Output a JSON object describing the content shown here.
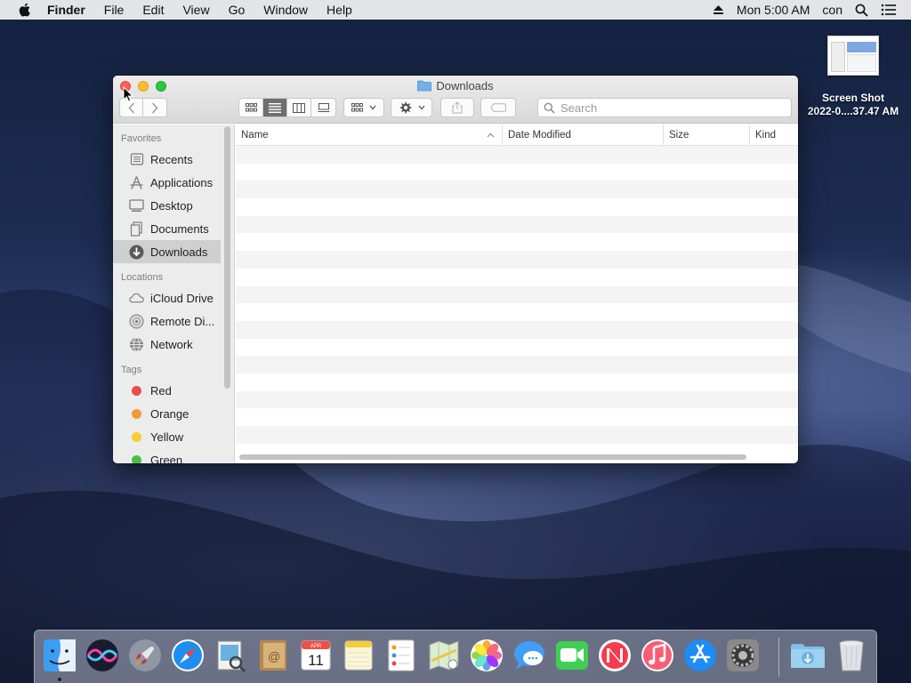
{
  "menubar": {
    "app": "Finder",
    "items": [
      "File",
      "Edit",
      "View",
      "Go",
      "Window",
      "Help"
    ],
    "clock": "Mon 5:00 AM",
    "user": "con"
  },
  "desktop": {
    "icon_label_line1": "Screen Shot",
    "icon_label_line2": "2022-0....37.47 AM"
  },
  "window": {
    "title": "Downloads",
    "search_placeholder": "Search",
    "columns": [
      "Name",
      "Date Modified",
      "Size",
      "Kind"
    ],
    "sort_column": "Name"
  },
  "sidebar": {
    "favorites_label": "Favorites",
    "favorites": [
      "Recents",
      "Applications",
      "Desktop",
      "Documents",
      "Downloads"
    ],
    "selected": "Downloads",
    "locations_label": "Locations",
    "locations": [
      "iCloud Drive",
      "Remote Di...",
      "Network"
    ],
    "tags_label": "Tags",
    "tags": [
      {
        "name": "Red",
        "color": "#eb4b4b"
      },
      {
        "name": "Orange",
        "color": "#f19a38"
      },
      {
        "name": "Yellow",
        "color": "#f5cf2f"
      },
      {
        "name": "Green",
        "color": "#4cc043"
      }
    ]
  },
  "dock": {
    "apps": [
      "Finder",
      "Siri",
      "Launchpad",
      "Safari",
      "Preview",
      "Contacts",
      "Calendar",
      "Notes",
      "Reminders",
      "Maps",
      "Photos",
      "Messages",
      "FaceTime",
      "News",
      "iTunes",
      "App Store",
      "System Preferences"
    ],
    "calendar_month": "APR",
    "calendar_day": "11",
    "contacts_glyph": "@",
    "stacks": [
      "Downloads",
      "Trash"
    ]
  }
}
